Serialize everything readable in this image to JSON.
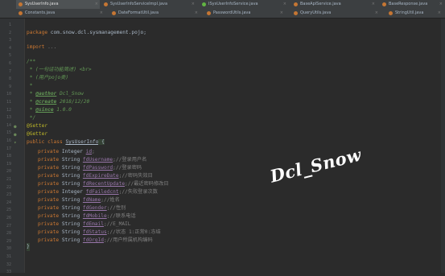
{
  "tabs_row1": [
    {
      "label": "SysUserInfo.java",
      "icon": "java-class-icon",
      "color": "#c57633",
      "active": true
    },
    {
      "label": "SysUserInfoServiceImpl.java",
      "icon": "java-class-icon",
      "color": "#c57633",
      "active": false
    },
    {
      "label": "ISysUserInfoService.java",
      "icon": "java-interface-icon",
      "color": "#62b543",
      "active": false
    },
    {
      "label": "BaseApiService.java",
      "icon": "java-class-icon",
      "color": "#c57633",
      "active": false
    },
    {
      "label": "BaseResponse.java",
      "icon": "java-class-icon",
      "color": "#c57633",
      "active": false
    }
  ],
  "tabs_row2": [
    {
      "label": "Constants.java",
      "icon": "java-class-icon",
      "color": "#c57633",
      "active": false
    },
    {
      "label": "DateFormatUtil.java",
      "icon": "java-class-icon",
      "color": "#c57633",
      "active": false
    },
    {
      "label": "PasswordUtils.java",
      "icon": "java-class-icon",
      "color": "#c57633",
      "active": false
    },
    {
      "label": "QueryUtils.java",
      "icon": "java-class-icon",
      "color": "#c57633",
      "active": false
    },
    {
      "label": "StringUtil.java",
      "icon": "java-class-icon",
      "color": "#c57633",
      "active": false
    }
  ],
  "editor": {
    "line_numbers": [
      "1",
      "2",
      "3",
      "4",
      "5",
      "6",
      "7",
      "8",
      "9",
      "10",
      "11",
      "12",
      "13",
      "14",
      "15",
      "16",
      "17",
      "18",
      "19",
      "20",
      "21",
      "22",
      "23",
      "24",
      "25",
      "26",
      "27",
      "28",
      "29",
      "30",
      "31",
      "32",
      "33"
    ],
    "package_kw": "package",
    "package_name": " com.snow.dcl.sysmanagement.pojo;",
    "import_kw": "import",
    "import_rest": " ...",
    "doc_open": "/**",
    "doc_desc": " * (一句话功能简述) <br>",
    "doc_detail": " * (用户pojo类)",
    "doc_blank": " *",
    "author_prefix": " * ",
    "author_tag": "@author",
    "author_val": " Dcl_Snow",
    "create_prefix": " * ",
    "create_tag": "@create",
    "create_val": " 2018/12/20",
    "since_prefix": " * ",
    "since_tag": "@since",
    "since_val": " 1.0.0",
    "doc_close": " */",
    "annotation1": "@Setter",
    "annotation2": "@Getter",
    "class_kw": "public class ",
    "class_name": "SysUserInfo",
    "class_brace": " {",
    "fields": [
      {
        "mod": "private ",
        "type": "Integer ",
        "name": "id",
        "comment": ";"
      },
      {
        "mod": "private ",
        "type": "String ",
        "name": "fdUsername",
        "comment": ";//登录用户名"
      },
      {
        "mod": "private ",
        "type": "String ",
        "name": "fdPassword",
        "comment": ";//登录密码"
      },
      {
        "mod": "private ",
        "type": "String ",
        "name": "fdExpireDate",
        "comment": ";//密码失效日"
      },
      {
        "mod": "private ",
        "type": "String ",
        "name": "fdRecentUpdate",
        "comment": ";//最近密码修改日"
      },
      {
        "mod": "private ",
        "type": "Integer ",
        "name": "fdFailedcnt",
        "comment": ";//失败登录次数"
      },
      {
        "mod": "private ",
        "type": "String ",
        "name": "fdName",
        "comment": ";//姓名"
      },
      {
        "mod": "private ",
        "type": "String ",
        "name": "fdGender",
        "comment": ";//性别"
      },
      {
        "mod": "private ",
        "type": "String ",
        "name": "fdMobile",
        "comment": ";//联系电话"
      },
      {
        "mod": "private ",
        "type": "String ",
        "name": "fdEmail",
        "comment": ";//E_MAIL"
      },
      {
        "mod": "private ",
        "type": "String ",
        "name": "fdStatus",
        "comment": ";//状态 1:正常0:冻结"
      },
      {
        "mod": "private ",
        "type": "String ",
        "name": "fdOrgId",
        "comment": ";//用户所属机构编码"
      }
    ],
    "closing_brace": "}"
  },
  "watermark": "Dcl_Snow"
}
